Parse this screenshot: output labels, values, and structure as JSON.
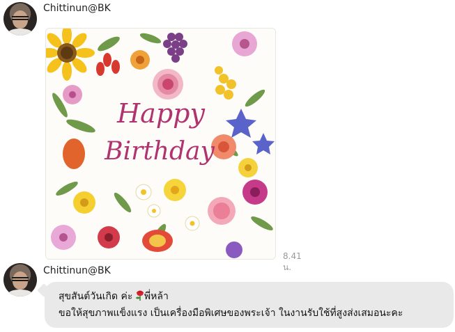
{
  "messages": [
    {
      "sender": "Chittinun@BK",
      "type": "image",
      "image": {
        "headline_line1": "Happy",
        "headline_line2": "Birthday"
      },
      "time": "8.41 น."
    },
    {
      "sender": "Chittinun@BK",
      "type": "text",
      "line1_before_icon": "สุขสันต์วันเกิด ค่ะ ",
      "inline_icon": "red-rose-icon",
      "line1_after_icon": "พี่หล้า",
      "line2": "ขอให้สุขภาพแข็งแรง เป็นเครื่องมือพิเศษของพระเจ้า ในงานรับใช้ที่สูงส่งเสมอนะคะ"
    }
  ],
  "colors": {
    "bubble": "#e9e9ea",
    "headline": "#b0326e",
    "timestamp": "#9a9a9a"
  }
}
